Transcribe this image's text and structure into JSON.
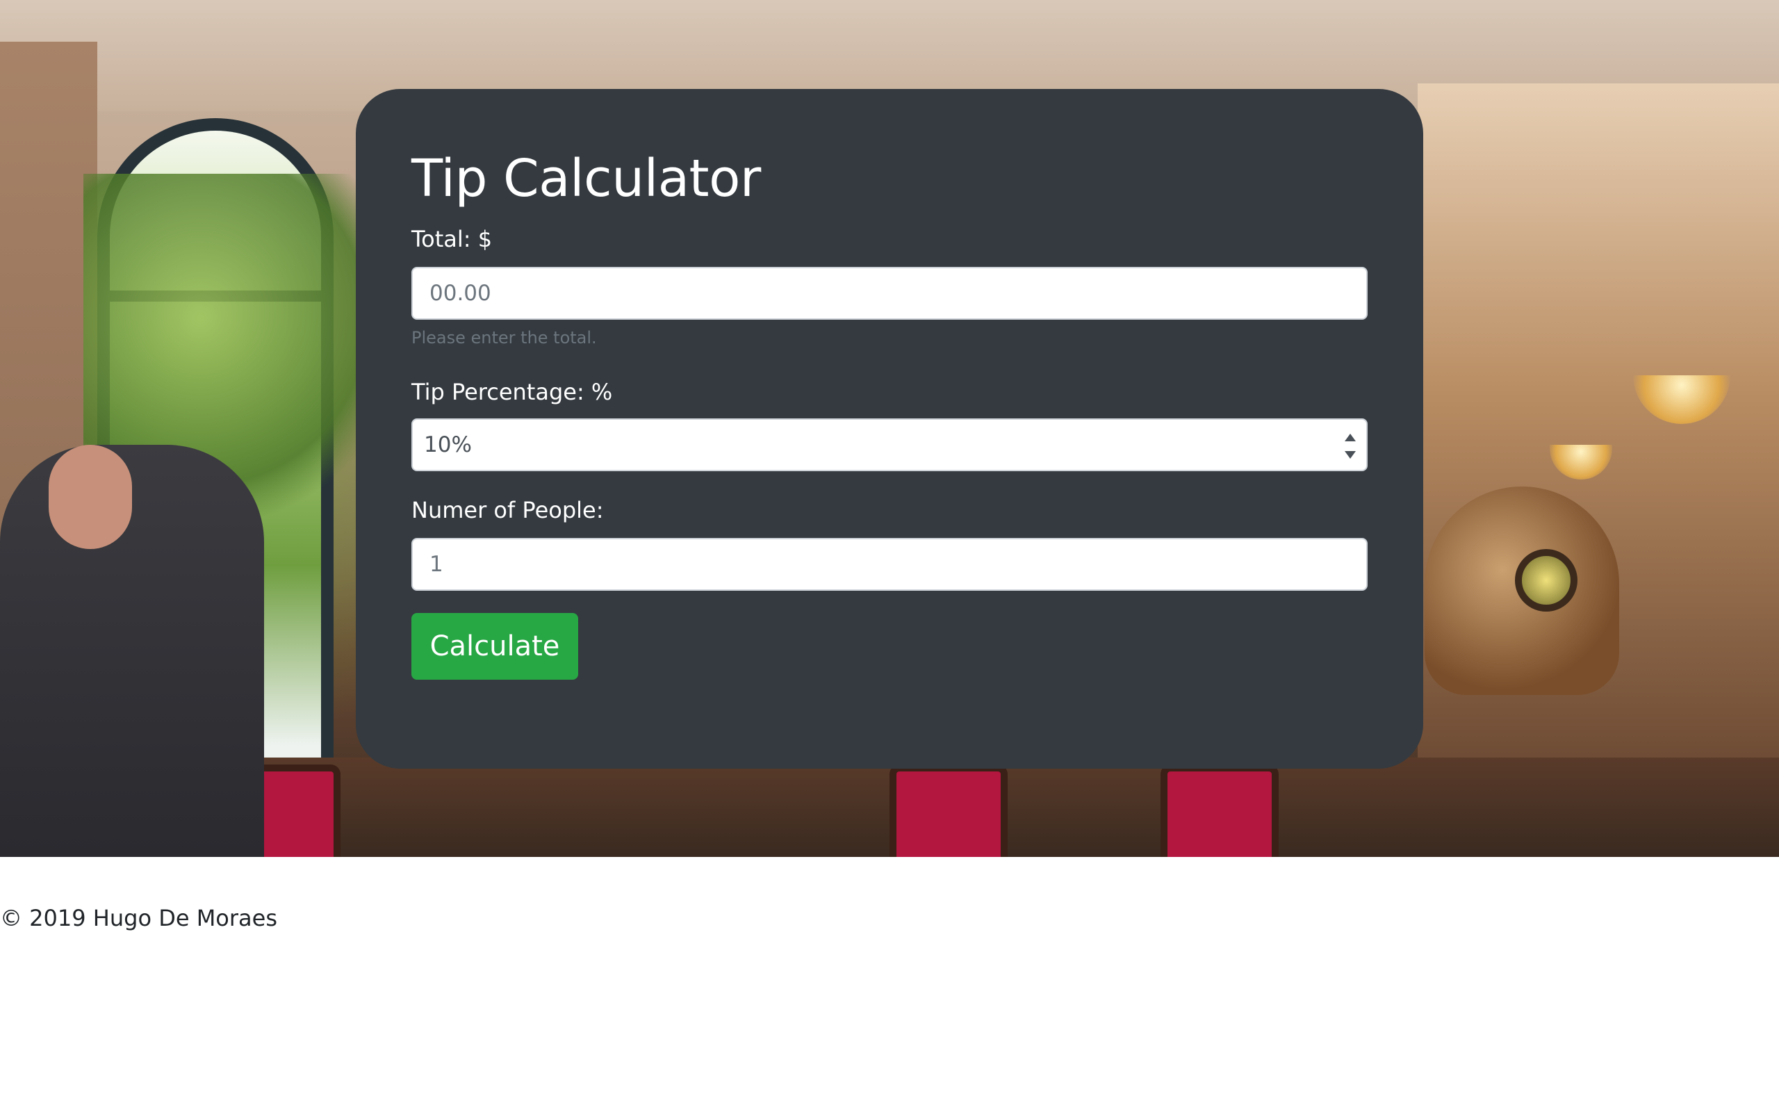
{
  "calculator": {
    "title": "Tip Calculator",
    "total": {
      "label": "Total: $",
      "placeholder": "00.00",
      "help": "Please enter the total."
    },
    "tip": {
      "label": "Tip Percentage: %",
      "selected": "10%"
    },
    "people": {
      "label": "Numer of People:",
      "placeholder": "1"
    },
    "calculate_label": "Calculate"
  },
  "footer": {
    "copyright": "© 2019 Hugo De Moraes"
  },
  "colors": {
    "card_bg": "#343a40",
    "button_bg": "#28a745",
    "help_text": "#6c757d"
  }
}
